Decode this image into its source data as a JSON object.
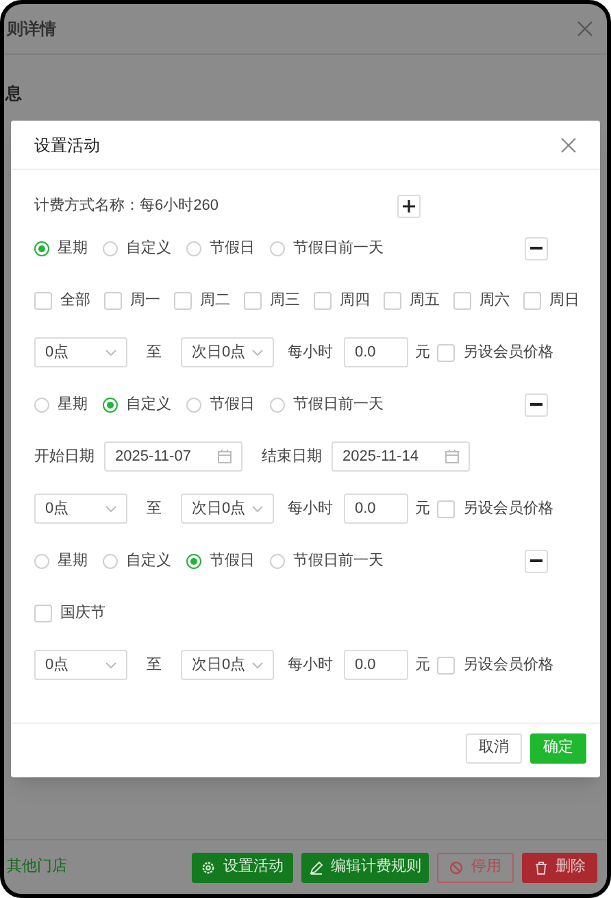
{
  "background": {
    "title": "则详情",
    "section": "息",
    "link": "其他门店",
    "buttons": [
      {
        "label": "设置活动",
        "kind": "activity"
      },
      {
        "label": "编辑计费规则",
        "kind": "edit"
      },
      {
        "label": "停用",
        "kind": "disable"
      },
      {
        "label": "删除",
        "kind": "delete"
      }
    ]
  },
  "dialog": {
    "title": "设置活动",
    "name_label": "计费方式名称：",
    "name_value": "每6小时260",
    "rules": [
      {
        "kind": "weekly",
        "options": [
          {
            "label": "星期",
            "selected": true
          },
          {
            "label": "自定义",
            "selected": false
          },
          {
            "label": "节假日",
            "selected": false
          },
          {
            "label": "节假日前一天",
            "selected": false
          }
        ],
        "days": [
          {
            "label": "全部",
            "checked": false
          },
          {
            "label": "周一",
            "checked": false
          },
          {
            "label": "周二",
            "checked": false
          },
          {
            "label": "周三",
            "checked": false
          },
          {
            "label": "周四",
            "checked": false
          },
          {
            "label": "周五",
            "checked": false
          },
          {
            "label": "周六",
            "checked": false
          },
          {
            "label": "周日",
            "checked": false
          }
        ],
        "time": {
          "start": "0点",
          "to": "至",
          "end": "次日0点",
          "per_hour": "每小时",
          "price": "0.0",
          "unit": "元",
          "member_label": "另设会员价格",
          "member_checked": false
        }
      },
      {
        "kind": "custom",
        "options": [
          {
            "label": "星期",
            "selected": false
          },
          {
            "label": "自定义",
            "selected": true
          },
          {
            "label": "节假日",
            "selected": false
          },
          {
            "label": "节假日前一天",
            "selected": false
          }
        ],
        "start_label": "开始日期",
        "start_date": "2025-11-07",
        "end_label": "结束日期",
        "end_date": "2025-11-14",
        "time": {
          "start": "0点",
          "to": "至",
          "end": "次日0点",
          "per_hour": "每小时",
          "price": "0.0",
          "unit": "元",
          "member_label": "另设会员价格",
          "member_checked": false
        }
      },
      {
        "kind": "holiday",
        "options": [
          {
            "label": "星期",
            "selected": false
          },
          {
            "label": "自定义",
            "selected": false
          },
          {
            "label": "节假日",
            "selected": true
          },
          {
            "label": "节假日前一天",
            "selected": false
          }
        ],
        "holidays": [
          {
            "label": "国庆节",
            "checked": false
          }
        ],
        "time": {
          "start": "0点",
          "to": "至",
          "end": "次日0点",
          "per_hour": "每小时",
          "price": "0.0",
          "unit": "元",
          "member_label": "另设会员价格",
          "member_checked": false
        }
      }
    ],
    "cancel": "取消",
    "ok": "确定"
  }
}
